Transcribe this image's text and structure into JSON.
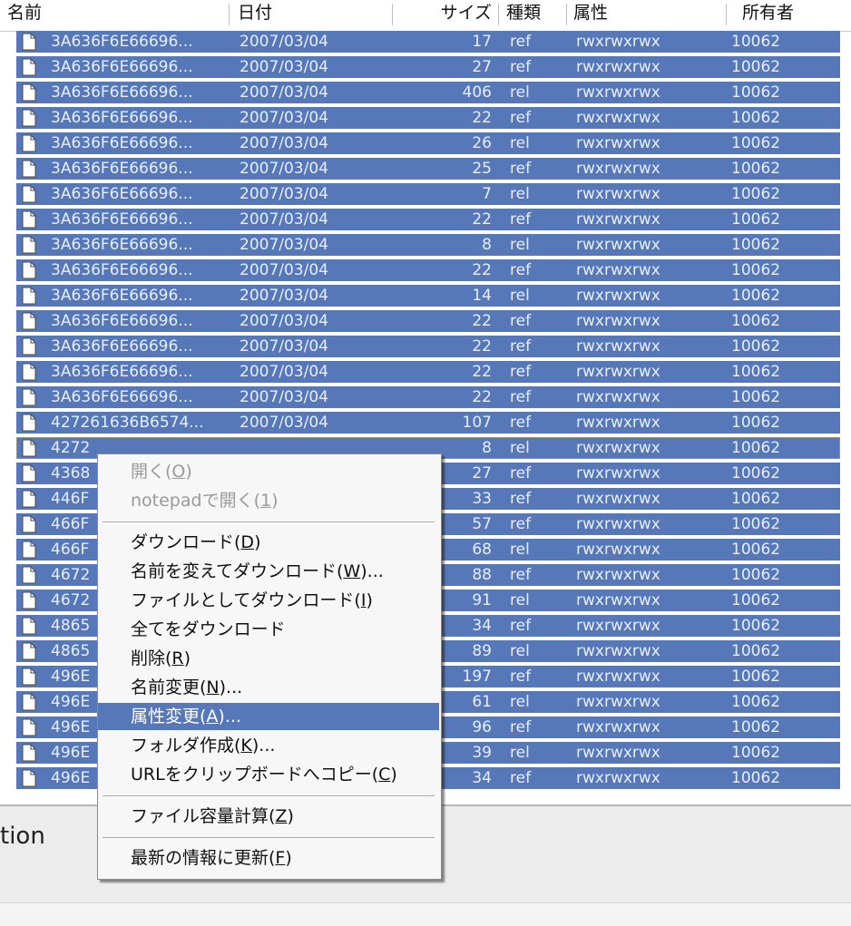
{
  "columns": {
    "name": "名前",
    "date": "日付",
    "size": "サイズ",
    "type": "種類",
    "attr": "属性",
    "owner": "所有者"
  },
  "rows": [
    {
      "name": "3A636F6E66696...",
      "date": "2007/03/04",
      "size": "17",
      "type": "ref",
      "attr": "rwxrwxrwx",
      "owner": "10062"
    },
    {
      "name": "3A636F6E66696...",
      "date": "2007/03/04",
      "size": "27",
      "type": "ref",
      "attr": "rwxrwxrwx",
      "owner": "10062"
    },
    {
      "name": "3A636F6E66696...",
      "date": "2007/03/04",
      "size": "406",
      "type": "rel",
      "attr": "rwxrwxrwx",
      "owner": "10062"
    },
    {
      "name": "3A636F6E66696...",
      "date": "2007/03/04",
      "size": "22",
      "type": "ref",
      "attr": "rwxrwxrwx",
      "owner": "10062"
    },
    {
      "name": "3A636F6E66696...",
      "date": "2007/03/04",
      "size": "26",
      "type": "rel",
      "attr": "rwxrwxrwx",
      "owner": "10062"
    },
    {
      "name": "3A636F6E66696...",
      "date": "2007/03/04",
      "size": "25",
      "type": "ref",
      "attr": "rwxrwxrwx",
      "owner": "10062"
    },
    {
      "name": "3A636F6E66696...",
      "date": "2007/03/04",
      "size": "7",
      "type": "rel",
      "attr": "rwxrwxrwx",
      "owner": "10062"
    },
    {
      "name": "3A636F6E66696...",
      "date": "2007/03/04",
      "size": "22",
      "type": "ref",
      "attr": "rwxrwxrwx",
      "owner": "10062"
    },
    {
      "name": "3A636F6E66696...",
      "date": "2007/03/04",
      "size": "8",
      "type": "rel",
      "attr": "rwxrwxrwx",
      "owner": "10062"
    },
    {
      "name": "3A636F6E66696...",
      "date": "2007/03/04",
      "size": "22",
      "type": "ref",
      "attr": "rwxrwxrwx",
      "owner": "10062"
    },
    {
      "name": "3A636F6E66696...",
      "date": "2007/03/04",
      "size": "14",
      "type": "rel",
      "attr": "rwxrwxrwx",
      "owner": "10062"
    },
    {
      "name": "3A636F6E66696...",
      "date": "2007/03/04",
      "size": "22",
      "type": "ref",
      "attr": "rwxrwxrwx",
      "owner": "10062"
    },
    {
      "name": "3A636F6E66696...",
      "date": "2007/03/04",
      "size": "22",
      "type": "ref",
      "attr": "rwxrwxrwx",
      "owner": "10062"
    },
    {
      "name": "3A636F6E66696...",
      "date": "2007/03/04",
      "size": "22",
      "type": "ref",
      "attr": "rwxrwxrwx",
      "owner": "10062"
    },
    {
      "name": "3A636F6E66696...",
      "date": "2007/03/04",
      "size": "22",
      "type": "ref",
      "attr": "rwxrwxrwx",
      "owner": "10062"
    },
    {
      "name": "427261636B6574...",
      "date": "2007/03/04",
      "size": "107",
      "type": "ref",
      "attr": "rwxrwxrwx",
      "owner": "10062"
    },
    {
      "name": "4272",
      "date": "",
      "size": "8",
      "type": "rel",
      "attr": "rwxrwxrwx",
      "owner": "10062",
      "focused": true
    },
    {
      "name": "4368",
      "date": "",
      "size": "27",
      "type": "ref",
      "attr": "rwxrwxrwx",
      "owner": "10062"
    },
    {
      "name": "446F",
      "date": "",
      "size": "33",
      "type": "ref",
      "attr": "rwxrwxrwx",
      "owner": "10062"
    },
    {
      "name": "466F",
      "date": "",
      "size": "57",
      "type": "ref",
      "attr": "rwxrwxrwx",
      "owner": "10062"
    },
    {
      "name": "466F",
      "date": "",
      "size": "68",
      "type": "rel",
      "attr": "rwxrwxrwx",
      "owner": "10062"
    },
    {
      "name": "4672",
      "date": "",
      "size": "88",
      "type": "ref",
      "attr": "rwxrwxrwx",
      "owner": "10062"
    },
    {
      "name": "4672",
      "date": "",
      "size": "91",
      "type": "rel",
      "attr": "rwxrwxrwx",
      "owner": "10062"
    },
    {
      "name": "4865",
      "date": "",
      "size": "34",
      "type": "ref",
      "attr": "rwxrwxrwx",
      "owner": "10062"
    },
    {
      "name": "4865",
      "date": "",
      "size": "89",
      "type": "rel",
      "attr": "rwxrwxrwx",
      "owner": "10062"
    },
    {
      "name": "496E",
      "date": "",
      "size": "197",
      "type": "ref",
      "attr": "rwxrwxrwx",
      "owner": "10062"
    },
    {
      "name": "496E",
      "date": "",
      "size": "61",
      "type": "rel",
      "attr": "rwxrwxrwx",
      "owner": "10062"
    },
    {
      "name": "496E",
      "date": "",
      "size": "96",
      "type": "ref",
      "attr": "rwxrwxrwx",
      "owner": "10062"
    },
    {
      "name": "496E",
      "date": "",
      "size": "39",
      "type": "rel",
      "attr": "rwxrwxrwx",
      "owner": "10062"
    },
    {
      "name": "496E",
      "date": "",
      "size": "34",
      "type": "ref",
      "attr": "rwxrwxrwx",
      "owner": "10062"
    }
  ],
  "context_menu": [
    {
      "label": "開く(",
      "key": "O",
      "tail": ")",
      "disabled": true
    },
    {
      "label": "notepadで開く(",
      "key": "1",
      "tail": ")",
      "disabled": true
    },
    {
      "separator": true
    },
    {
      "label": "ダウンロード(",
      "key": "D",
      "tail": ")"
    },
    {
      "label": "名前を変えてダウンロード(",
      "key": "W",
      "tail": ")..."
    },
    {
      "label": "ファイルとしてダウンロード(",
      "key": "I",
      "tail": ")"
    },
    {
      "label": "全てをダウンロード",
      "key": "",
      "tail": ""
    },
    {
      "label": "削除(",
      "key": "R",
      "tail": ")"
    },
    {
      "label": "名前変更(",
      "key": "N",
      "tail": ")..."
    },
    {
      "label": "属性変更(",
      "key": "A",
      "tail": ")...",
      "selected": true
    },
    {
      "label": "フォルダ作成(",
      "key": "K",
      "tail": ")..."
    },
    {
      "label": "URLをクリップボードへコピー(",
      "key": "C",
      "tail": ")"
    },
    {
      "separator": true
    },
    {
      "label": "ファイル容量計算(",
      "key": "Z",
      "tail": ")"
    },
    {
      "separator": true
    },
    {
      "label": "最新の情報に更新(",
      "key": "F",
      "tail": ")"
    }
  ],
  "bottom_pane": {
    "label": "tion"
  },
  "colors": {
    "selection": "#5677b8",
    "selection_text": "#e8eefb",
    "menu_bg": "#f7f7f7"
  },
  "icons": {
    "file": "document-icon"
  }
}
